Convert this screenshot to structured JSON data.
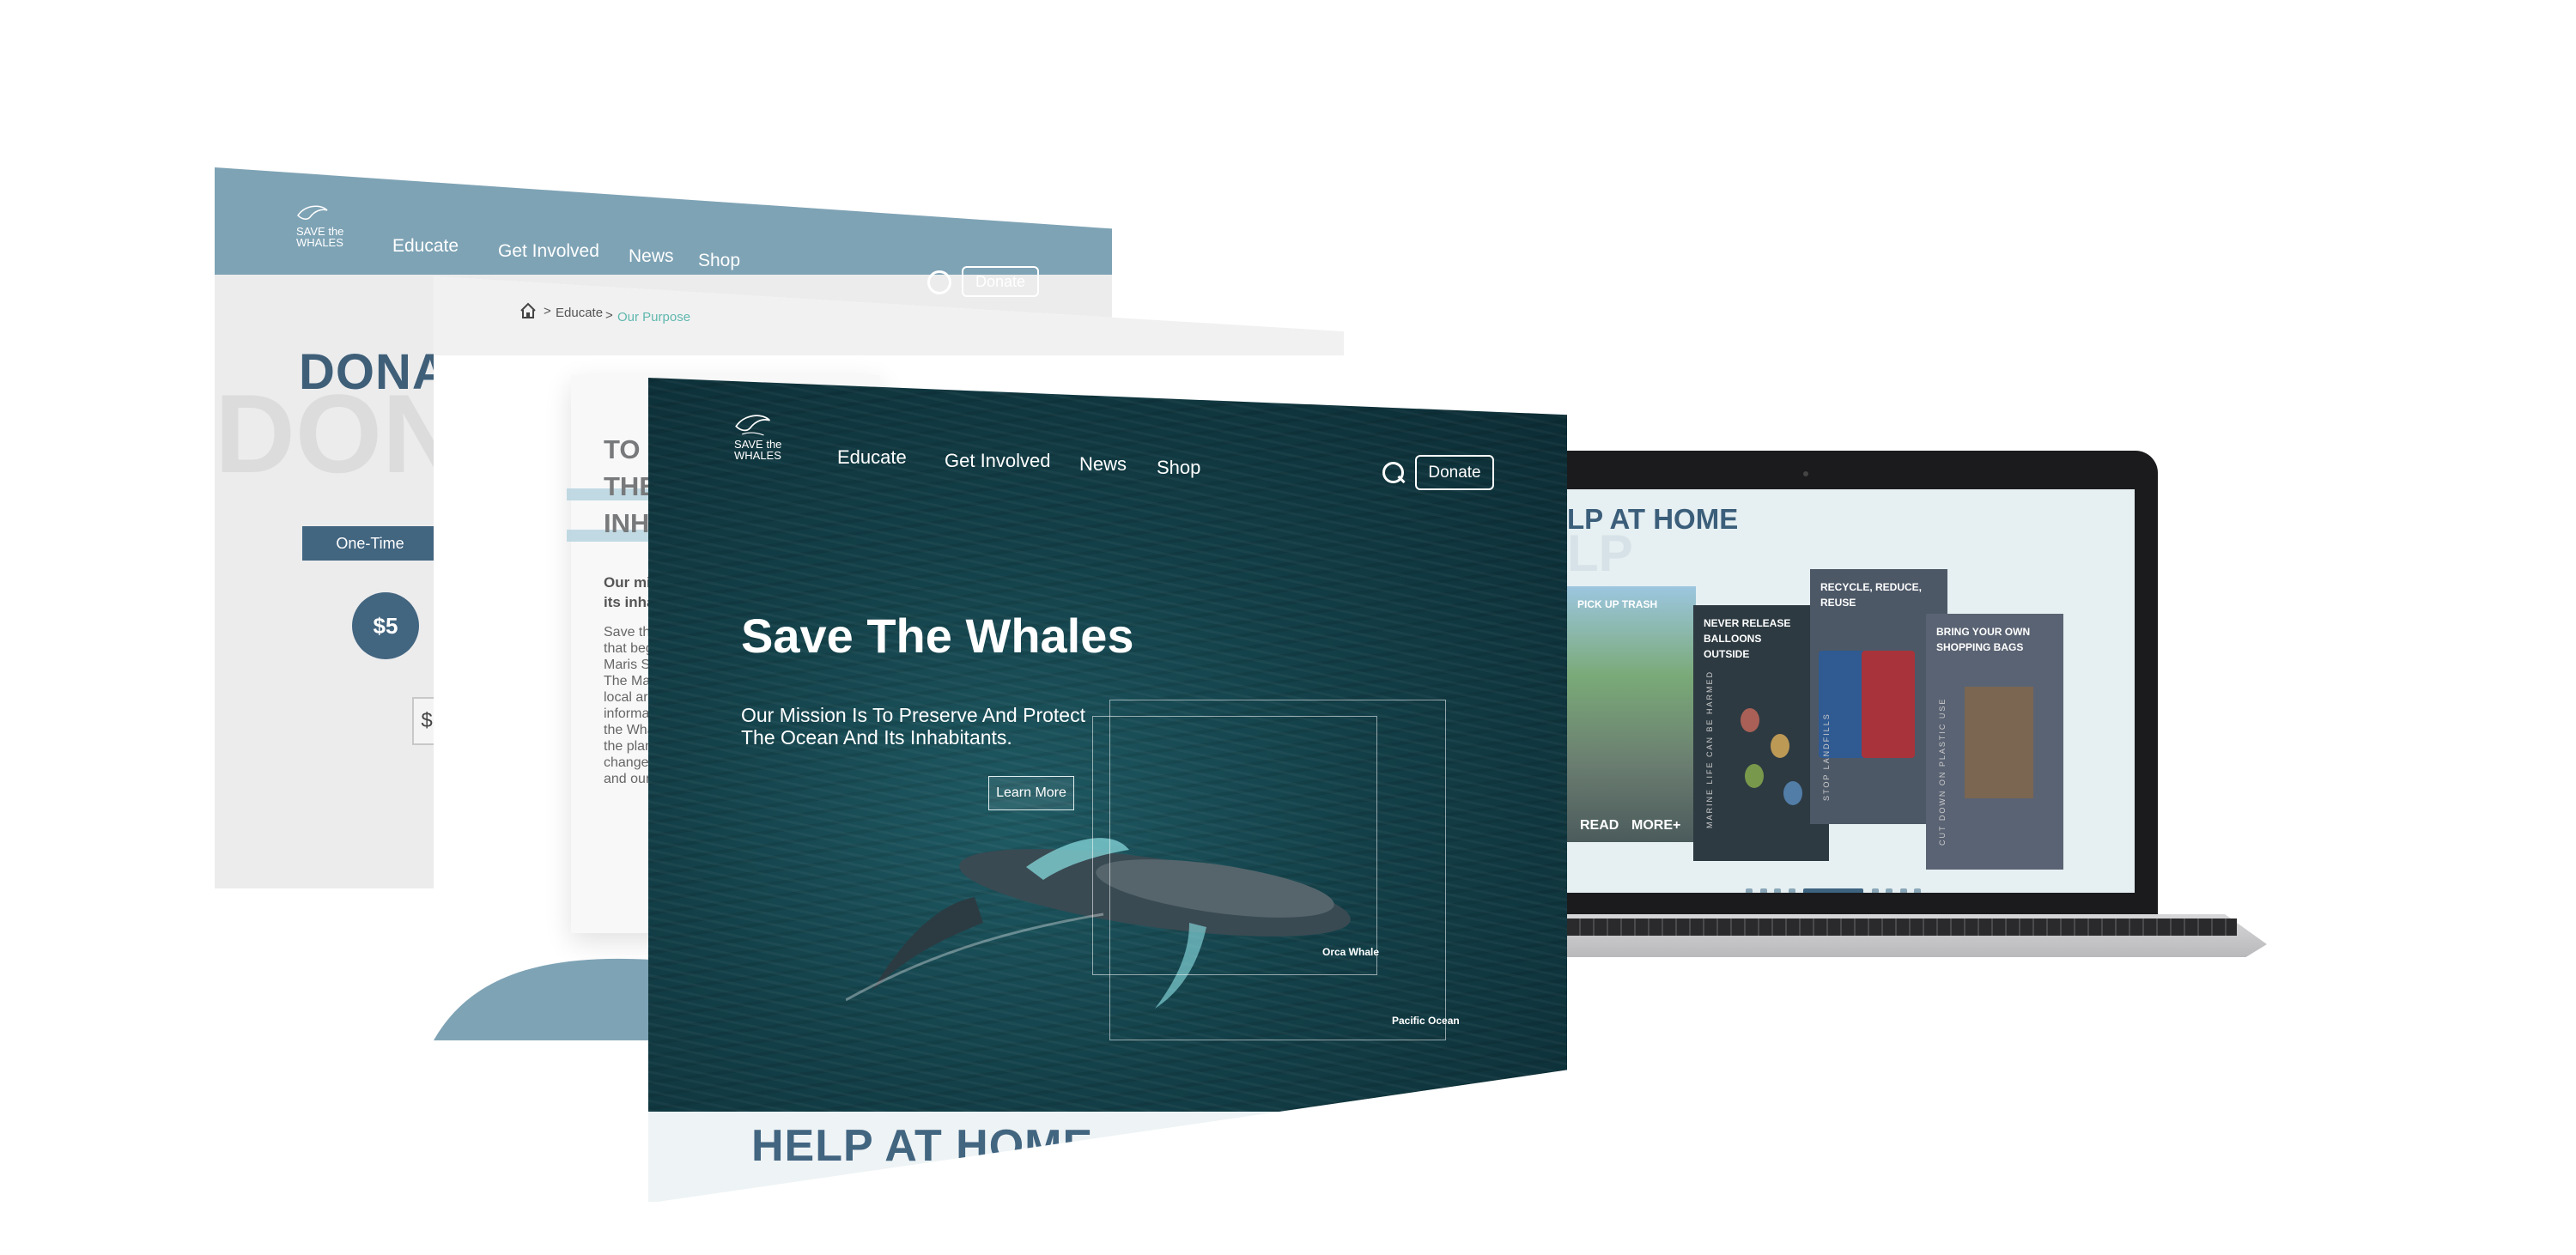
{
  "brand": {
    "logo_line1": "SAVE the",
    "logo_line2": "WHALES"
  },
  "nav": {
    "items": [
      "Educate",
      "Get Involved",
      "News",
      "Shop"
    ],
    "donate_label": "Donate"
  },
  "donate_page": {
    "title": "DONA",
    "ghost_title": "DON",
    "tab_one_time": "One-Time",
    "amount_5": "$5",
    "custom_amount_prefix": "$"
  },
  "purpose_page": {
    "breadcrumb": [
      "Educate",
      "Our Purpose"
    ],
    "breadcrumb_sep": ">",
    "heading_lines": [
      "TO P",
      "THE",
      "INHA"
    ],
    "intro_bold": "Our mis\nits inhab",
    "body_lines": [
      "Save the",
      "that beg",
      "Maris Sh",
      "The Mar",
      "local art",
      "informa",
      "the Wha",
      "the plan",
      "change.",
      "and our"
    ]
  },
  "hero_page": {
    "title": "Save The Whales",
    "subtitle": "Our Mission Is To Preserve And Protect The Ocean And Its Inhabitants.",
    "cta": "Learn More",
    "label_orca": "Orca Whale",
    "label_ocean": "Pacific Ocean",
    "next_section": "HELP AT HOME"
  },
  "laptop": {
    "section_title": "LP AT HOME",
    "ghost": "LP",
    "cards": [
      {
        "title": "PICK UP TRASH",
        "vertical": "",
        "read": "READ",
        "more": "MORE+"
      },
      {
        "title": "NEVER RELEASE BALLOONS OUTSIDE",
        "vertical": "MARINE LIFE CAN BE HARMED"
      },
      {
        "title": "RECYCLE, REDUCE, REUSE",
        "vertical": "STOP LANDFILLS"
      },
      {
        "title": "BRING YOUR OWN SHOPPING BAGS",
        "vertical": "CUT DOWN ON PLASTIC USE"
      }
    ],
    "prev_arrow": "←",
    "next_arrow": "→"
  },
  "colors": {
    "nav_blue": "#7ea3b5",
    "navy": "#426580",
    "ocean": "#133f48",
    "teal_accent": "#5fb8ad"
  }
}
